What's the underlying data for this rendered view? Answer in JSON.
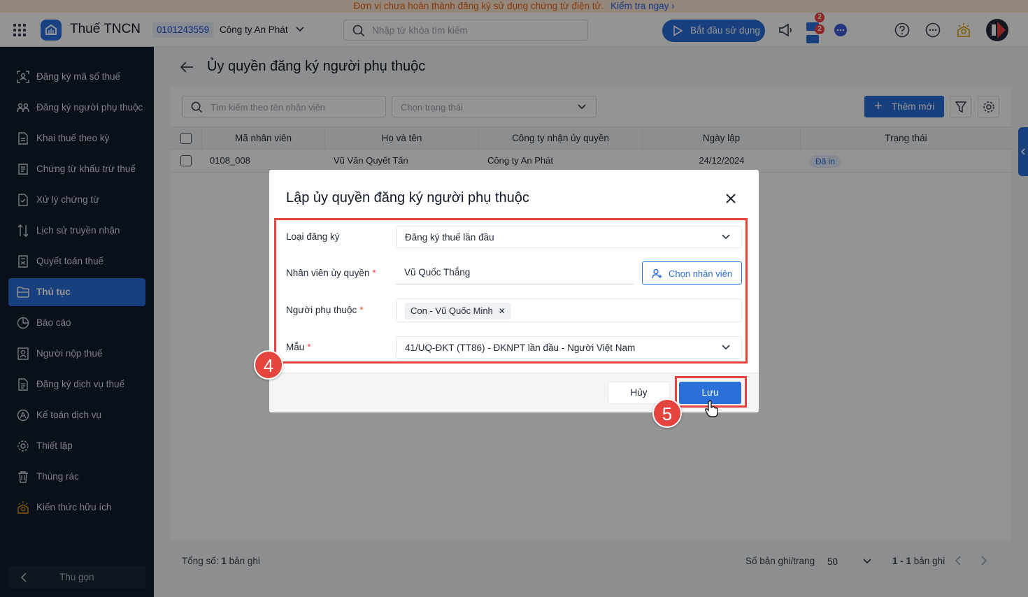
{
  "banner": {
    "message": "Đơn vị chưa hoàn thành đăng ký sử dụng chứng từ điện tử.",
    "link": "Kiểm tra ngay"
  },
  "topbar": {
    "app_title": "Thuế TNCN",
    "tax_code": "0101243559",
    "company": "Công ty An Phát",
    "search_placeholder": "Nhập từ khóa tìm kiếm",
    "start_button": "Bắt đầu sử dụng",
    "cart_badge_1": "2",
    "cart_badge_2": "2"
  },
  "sidebar": {
    "items": [
      {
        "label": "Đăng ký mã số thuế",
        "icon": "id-scan-icon"
      },
      {
        "label": "Đăng ký người phụ thuộc",
        "icon": "users-icon"
      },
      {
        "label": "Khai thuế theo kỳ",
        "icon": "document-icon"
      },
      {
        "label": "Chứng từ khấu trừ thuế",
        "icon": "receipt-icon"
      },
      {
        "label": "Xử lý chứng từ",
        "icon": "file-check-icon"
      },
      {
        "label": "Lịch sử truyền nhận",
        "icon": "transfer-icon"
      },
      {
        "label": "Quyết toán thuế",
        "icon": "calculator-icon"
      },
      {
        "label": "Thủ tục",
        "icon": "folder-icon",
        "active": true
      },
      {
        "label": "Báo cáo",
        "icon": "pie-chart-icon"
      },
      {
        "label": "Người nộp thuế",
        "icon": "person-card-icon"
      },
      {
        "label": "Đăng ký dịch vụ thuế",
        "icon": "register-icon"
      },
      {
        "label": "Kế toán dịch vụ",
        "icon": "accounting-icon"
      },
      {
        "label": "Thiết lập",
        "icon": "gear-icon"
      },
      {
        "label": "Thùng rác",
        "icon": "trash-icon"
      },
      {
        "label": "Kiến thức hữu ích",
        "icon": "lightbulb-icon"
      }
    ],
    "collapse_label": "Thu gọn"
  },
  "page": {
    "title": "Ủy quyền đăng ký người phụ thuộc",
    "search_placeholder": "Tìm kiếm theo tên nhân viên",
    "status_placeholder": "Chọn trạng thái",
    "add_button": "Thêm mới",
    "columns": [
      "Mã nhân viên",
      "Họ và tên",
      "Công ty nhận ủy quyền",
      "Ngày lập",
      "Trạng thái"
    ],
    "rows": [
      {
        "code": "0108_008",
        "name": "Vũ Văn Quyết Tấn",
        "company": "Công ty An Phát",
        "date": "24/12/2024",
        "status": "Đã in"
      }
    ],
    "footer": {
      "total_label": "Tổng số:",
      "total_value": "1",
      "total_unit": "bản ghi",
      "per_page_label": "Số bản ghi/trang",
      "per_page_value": "50",
      "range": "1 - 1",
      "range_unit": "bản ghi"
    }
  },
  "modal": {
    "title": "Lập ủy quyền đăng ký người phụ thuộc",
    "fields": {
      "type_label": "Loại đăng ký",
      "type_value": "Đăng ký thuế lần đầu",
      "employee_label": "Nhân viên ủy quyền",
      "employee_value": "Vũ Quốc Thắng",
      "choose_employee": "Chọn nhân viên",
      "dependent_label": "Người phụ thuộc",
      "dependent_tag": "Con - Vũ Quốc Minh",
      "template_label": "Mẫu",
      "template_value": "41/UQ-ĐKT (TT86) - ĐKNPT lần đầu - Người Việt Nam",
      "required_mark": "*"
    },
    "cancel": "Hủy",
    "save": "Lưu"
  },
  "annotations": {
    "step4": "4",
    "step5": "5",
    "highlight_color": "#e5433e"
  }
}
